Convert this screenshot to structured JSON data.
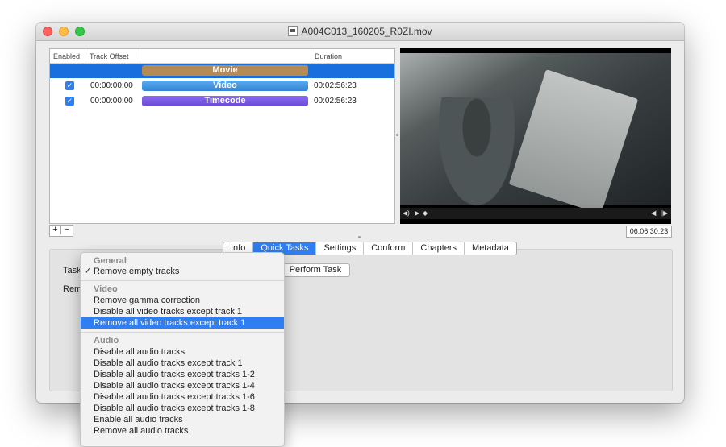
{
  "window": {
    "title": "A004C013_160205_R0ZI.mov"
  },
  "tracks_table": {
    "headers": {
      "enabled": "Enabled",
      "offset": "Track Offset",
      "name": "",
      "duration": "Duration"
    },
    "rows": [
      {
        "name": "Movie",
        "offset": "",
        "duration": "",
        "enabled": null,
        "color": "#b58a55"
      },
      {
        "name": "Video",
        "offset": "00:00:00:00",
        "duration": "00:02:56:23",
        "enabled": true,
        "color": "#4a9be0"
      },
      {
        "name": "Timecode",
        "offset": "00:00:00:00",
        "duration": "00:02:56:23",
        "enabled": true,
        "color": "#7b5ae0"
      }
    ],
    "add_label": "+",
    "remove_label": "−"
  },
  "player": {
    "timecode": "06:06:30:23",
    "controls": {
      "volume": "◀)",
      "play": "▶",
      "prev": "◀|",
      "next": "|▶"
    }
  },
  "tabs": [
    "Info",
    "Quick Tasks",
    "Settings",
    "Conform",
    "Chapters",
    "Metadata"
  ],
  "active_tab": "Quick Tasks",
  "quick_tasks": {
    "task_label": "Task",
    "remove_label": "Remo",
    "perform_button": "Perform Task"
  },
  "task_menu": {
    "sections": [
      {
        "header": "General",
        "items": [
          "Remove empty tracks"
        ]
      },
      {
        "header": "Video",
        "items": [
          "Remove gamma correction",
          "Disable all video tracks except track 1",
          "Remove all video tracks except track 1"
        ]
      },
      {
        "header": "Audio",
        "items": [
          "Disable all audio tracks",
          "Disable all audio tracks except track 1",
          "Disable all audio tracks except tracks 1-2",
          "Disable all audio tracks except tracks 1-4",
          "Disable all audio tracks except tracks 1-6",
          "Disable all audio tracks except tracks 1-8",
          "Enable all audio tracks",
          "Remove all audio tracks"
        ]
      }
    ],
    "checked_item": "Remove empty tracks",
    "highlighted_item": "Remove all video tracks except track 1",
    "check_mark": "✓"
  }
}
